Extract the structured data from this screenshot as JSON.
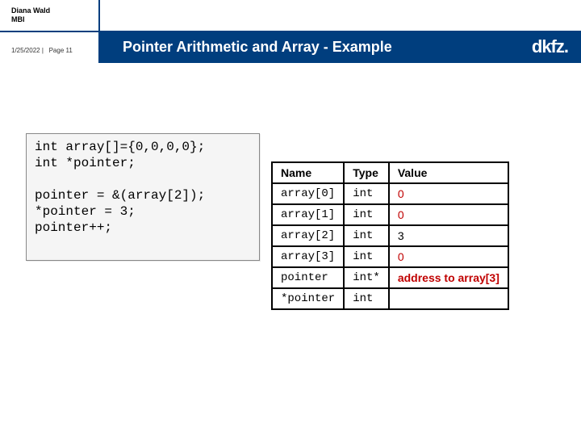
{
  "header": {
    "author_line1": "Diana Wald",
    "author_line2": "MBI",
    "date": "1/25/2022",
    "page": "Page 11",
    "title": "Pointer Arithmetic and Array - Example",
    "logo": "dkfz."
  },
  "code": {
    "line1": "int array[]={0,0,0,0};",
    "line2": "int *pointer;",
    "line3": "",
    "line4": "pointer = &(array[2]);",
    "line5": "*pointer = 3;",
    "line6": "pointer++;"
  },
  "table": {
    "headers": {
      "c1": "Name",
      "c2": "Type",
      "c3": "Value"
    },
    "rows": [
      {
        "name": "array[0]",
        "type": "int",
        "value": "0",
        "valueClass": "value-red"
      },
      {
        "name": "array[1]",
        "type": "int",
        "value": "0",
        "valueClass": "value-red"
      },
      {
        "name": "array[2]",
        "type": "int",
        "value": "3",
        "valueClass": "value-black"
      },
      {
        "name": "array[3]",
        "type": "int",
        "value": "0",
        "valueClass": "value-red"
      },
      {
        "name": "pointer",
        "type": "int*",
        "value": "address to array[3]",
        "valueClass": "value-red-b"
      },
      {
        "name": "*pointer",
        "type": "int",
        "value": "",
        "valueClass": ""
      }
    ]
  }
}
